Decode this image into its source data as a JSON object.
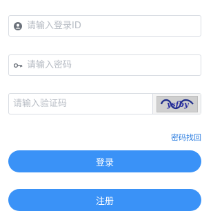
{
  "username": {
    "icon": "user-icon",
    "placeholder": "请输入登录ID",
    "value": ""
  },
  "password": {
    "icon": "key-icon",
    "placeholder": "请输入密码",
    "value": ""
  },
  "captcha": {
    "placeholder": "请输入验证码",
    "value": "",
    "image_text": "ysfby"
  },
  "forgot_password_link": "密码找回",
  "login_button": "登录",
  "register_button": "注册",
  "colors": {
    "accent": "#3a92f7",
    "link": "#2f7fe0",
    "border": "#d9dde3",
    "placeholder": "#b7bcc4"
  }
}
